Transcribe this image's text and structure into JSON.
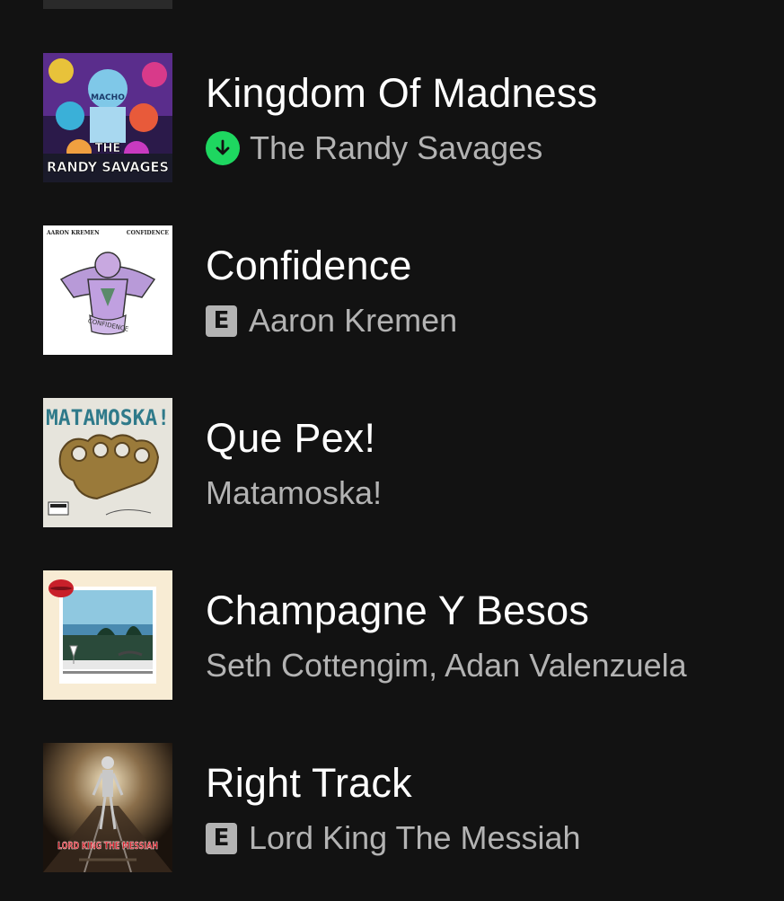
{
  "tracks": [
    {
      "title": "Kingdom Of Madness",
      "artist": "The Randy Savages",
      "badge": "downloaded",
      "cover_text": [
        "MACHO",
        "THE",
        "RANDY SAVAGES"
      ]
    },
    {
      "title": "Confidence",
      "artist": "Aaron Kremen",
      "badge": "explicit",
      "badge_label": "E",
      "cover_text": [
        "AARON KREMEN",
        "CONFIDENCE",
        "CONFIDENCE"
      ]
    },
    {
      "title": "Que Pex!",
      "artist": "Matamoska!",
      "badge": "none",
      "cover_text": [
        "MATAMOSKA!"
      ]
    },
    {
      "title": "Champagne Y Besos",
      "artist": "Seth Cottengim, Adan Valenzuela",
      "badge": "none",
      "cover_text": []
    },
    {
      "title": "Right Track",
      "artist": "Lord King The Messiah",
      "badge": "explicit",
      "badge_label": "E",
      "cover_text": [
        "LORD KING THE MESSIAH"
      ]
    }
  ],
  "colors": {
    "background": "#121212",
    "title": "#ffffff",
    "subtitle": "#b3b3b3",
    "download_green": "#1ed760"
  },
  "icons": {
    "download": "download-arrow-icon",
    "explicit": "explicit-badge-icon"
  }
}
